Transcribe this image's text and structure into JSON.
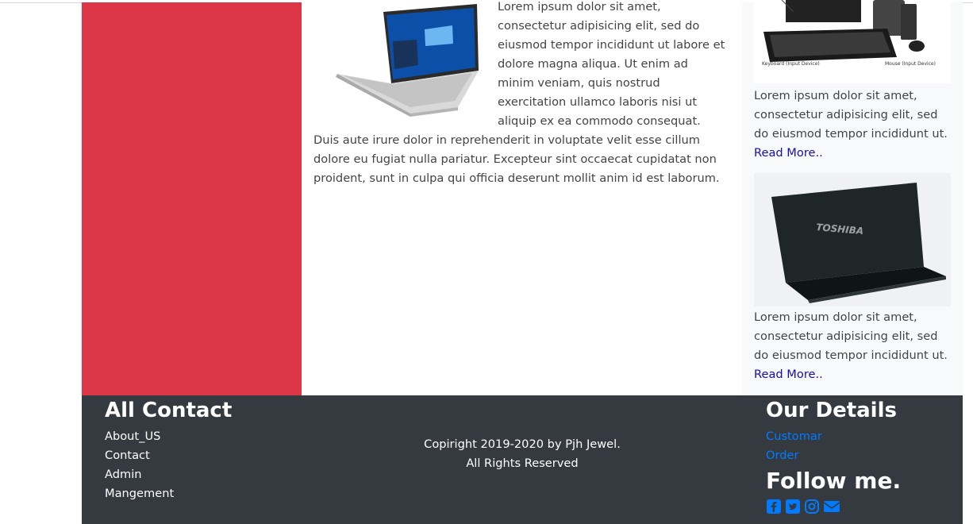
{
  "main": {
    "article_text": "Lorem ipsum dolor sit amet, consectetur adipisicing elit, sed do eiusmod tempor incididunt ut labore et dolore magna aliqua. Ut enim ad minim veniam, quis nostrud exercitation ullamco laboris nisi ut aliquip ex ea commodo consequat. Duis aute irure dolor in reprehenderit in voluptate velit esse cillum dolore eu fugiat nulla pariatur. Excepteur sint occaecat cupidatat non proident, sunt in culpa qui officia deserunt mollit anim id est laborum."
  },
  "sidebar": {
    "cards": [
      {
        "text": "Lorem ipsum dolor sit amet, consectetur adipisicing elit, sed do eiusmod tempor incididunt ut.",
        "link": "Read More.."
      },
      {
        "text": "Lorem ipsum dolor sit amet, consectetur adipisicing elit, sed do eiusmod tempor incididunt ut.",
        "link": "Read More..",
        "image_brand": "TOSHIBA"
      }
    ],
    "card1_labels": {
      "left": "Keyboard (Input Device)",
      "right": "Mouse (Input Device)"
    }
  },
  "footer": {
    "left_title": "All Contact",
    "left_links": [
      "About_US",
      "Contact",
      "Admin",
      "Mangement"
    ],
    "copyright_line1": "Copiright 2019-2020 by Pjh Jewel.",
    "copyright_line2": "All Rights Reserved",
    "right_title": "Our Details",
    "right_links": [
      "Customar",
      "Order"
    ],
    "follow_title": "Follow me.",
    "social_icons": [
      "facebook-icon",
      "twitter-icon",
      "instagram-icon",
      "envelope-icon"
    ]
  },
  "colors": {
    "red_panel": "#dc3545",
    "footer_bg": "#343a40",
    "link_blue": "#007bff",
    "read_more": "#1a0dab"
  }
}
